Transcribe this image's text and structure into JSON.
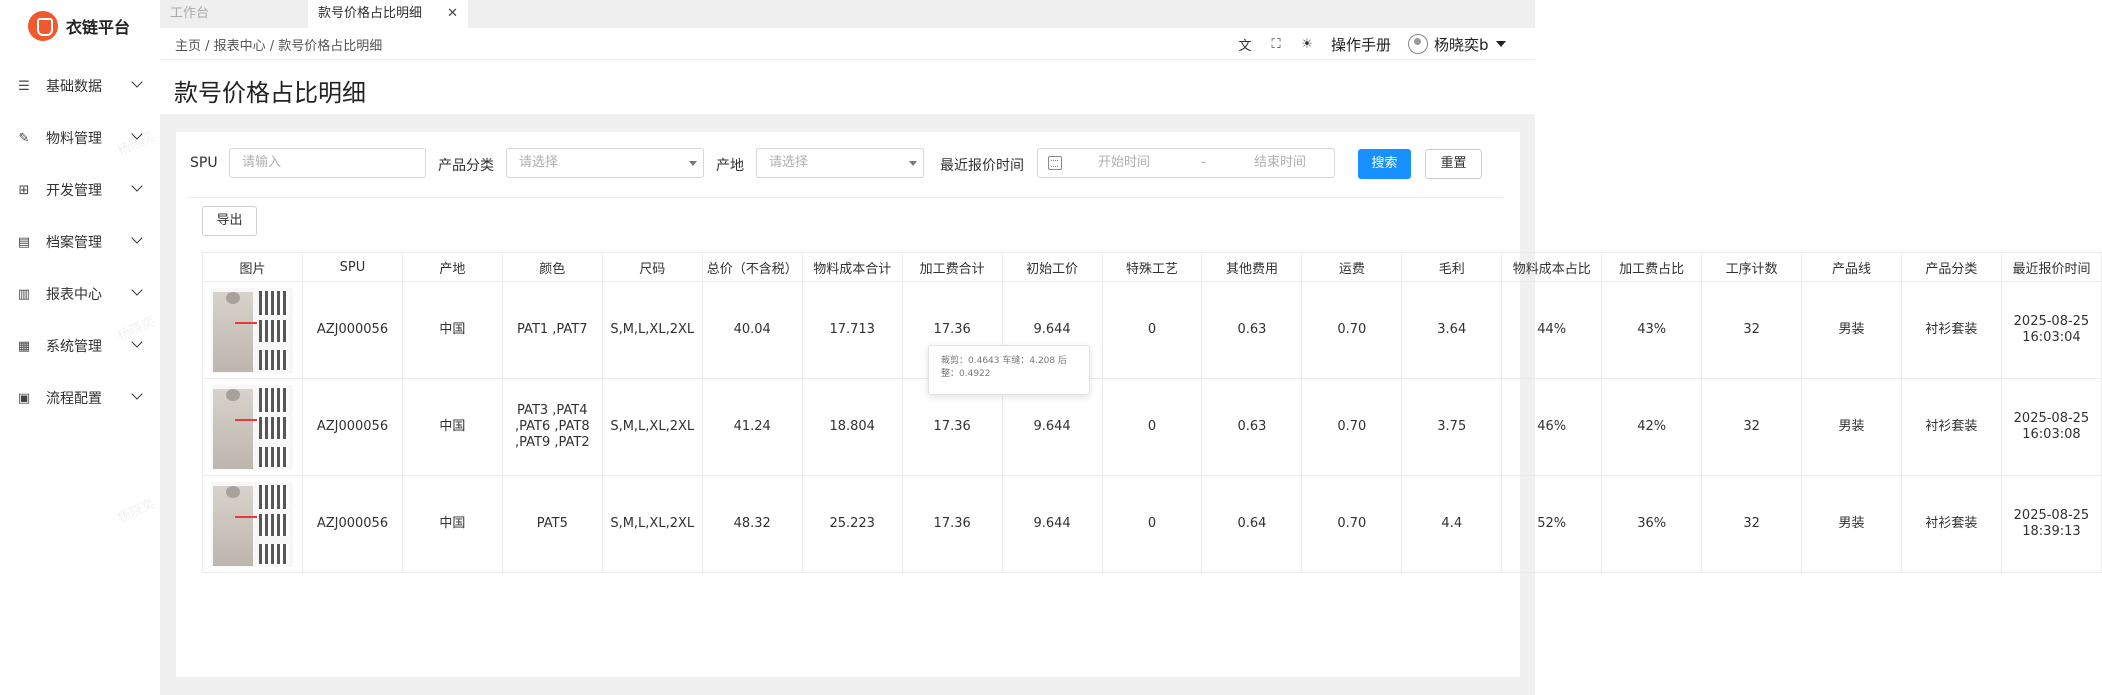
{
  "app": {
    "name": "衣链平台"
  },
  "sidebar": {
    "items": [
      {
        "label": "基础数据",
        "icon": "list-indent-icon"
      },
      {
        "label": "物料管理",
        "icon": "edit-box-icon"
      },
      {
        "label": "开发管理",
        "icon": "org-chart-icon"
      },
      {
        "label": "档案管理",
        "icon": "document-icon"
      },
      {
        "label": "报表中心",
        "icon": "report-file-icon"
      },
      {
        "label": "系统管理",
        "icon": "grid-icon"
      },
      {
        "label": "流程配置",
        "icon": "workflow-icon"
      }
    ]
  },
  "watermark": "杨晓奕",
  "tabs": [
    {
      "label": "工作台",
      "active": false
    },
    {
      "label": "款号价格占比明细",
      "active": true
    }
  ],
  "breadcrumb": "主页 / 报表中心 / 款号价格占比明细",
  "header": {
    "manual": "操作手册",
    "user": "杨晓奕b"
  },
  "page": {
    "title": "款号价格占比明细"
  },
  "filters": {
    "spu_label": "SPU",
    "spu_placeholder": "请输入",
    "category_label": "产品分类",
    "category_placeholder": "请选择",
    "origin_label": "产地",
    "origin_placeholder": "请选择",
    "date_label": "最近报价时间",
    "date_start": "开始时间",
    "date_sep": "-",
    "date_end": "结束时间",
    "search": "搜索",
    "reset": "重置"
  },
  "export": "导出",
  "table": {
    "columns": [
      "图片",
      "SPU",
      "产地",
      "颜色",
      "尺码",
      "总价（不含税）",
      "物料成本合计",
      "加工费合计",
      "初始工价",
      "特殊工艺",
      "其他费用",
      "运费",
      "毛利",
      "物料成本占比",
      "加工费占比",
      "工序计数",
      "产品线",
      "产品分类",
      "最近报价时间"
    ],
    "rows": [
      {
        "spu": "AZJ000056",
        "origin": "中国",
        "color": "PAT1 ,PAT7",
        "size": "S,M,L,XL,2XL",
        "total": "40.04",
        "material": "17.713",
        "processing": "17.36",
        "initial": "9.644",
        "special": "0",
        "other": "0.63",
        "freight": "0.70",
        "profit": "3.64",
        "material_ratio": "44%",
        "processing_ratio": "43%",
        "steps": "32",
        "line": "男装",
        "category": "衬衫套装",
        "quote_time": "2025-08-25 16:03:04"
      },
      {
        "spu": "AZJ000056",
        "origin": "中国",
        "color": "PAT3 ,PAT4 ,PAT6 ,PAT8 ,PAT9 ,PAT2",
        "size": "S,M,L,XL,2XL",
        "total": "41.24",
        "material": "18.804",
        "processing": "17.36",
        "initial": "9.644",
        "special": "0",
        "other": "0.63",
        "freight": "0.70",
        "profit": "3.75",
        "material_ratio": "46%",
        "processing_ratio": "42%",
        "steps": "32",
        "line": "男装",
        "category": "衬衫套装",
        "quote_time": "2025-08-25 16:03:08"
      },
      {
        "spu": "AZJ000056",
        "origin": "中国",
        "color": "PAT5",
        "size": "S,M,L,XL,2XL",
        "total": "48.32",
        "material": "25.223",
        "processing": "17.36",
        "initial": "9.644",
        "special": "0",
        "other": "0.64",
        "freight": "0.70",
        "profit": "4.4",
        "material_ratio": "52%",
        "processing_ratio": "36%",
        "steps": "32",
        "line": "男装",
        "category": "衬衫套装",
        "quote_time": "2025-08-25 18:39:13"
      }
    ]
  },
  "tooltip": "裁剪：0.4643 车缝：4.208 后整：0.4922"
}
